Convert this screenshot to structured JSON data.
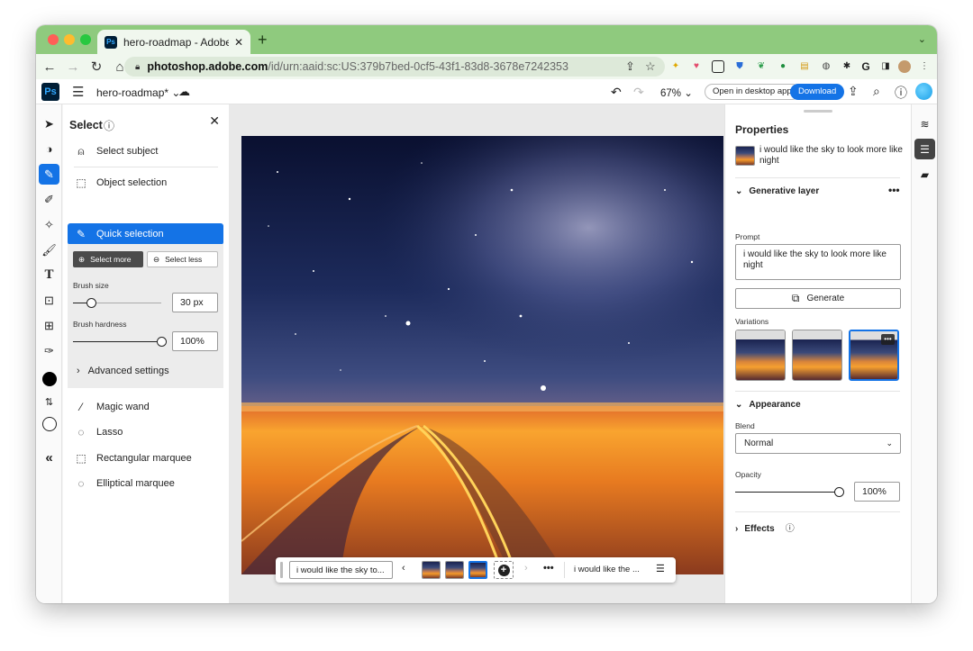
{
  "browser": {
    "tab_title": "hero-roadmap - Adobe Photos",
    "tab_favicon": "Ps",
    "url_domain": "photoshop.adobe.com",
    "url_path": "/id/urn:aaid:sc:US:379b7bed-0cf5-43f1-83d8-3678e7242353"
  },
  "app": {
    "logo": "Ps",
    "doc_name": "hero-roadmap*",
    "zoom": "67%",
    "open_desktop_label": "Open in desktop app",
    "download_label": "Download"
  },
  "select_panel": {
    "title": "Select",
    "items": {
      "select_subject": "Select subject",
      "object_selection": "Object selection",
      "quick_selection": "Quick selection",
      "magic_wand": "Magic wand",
      "lasso": "Lasso",
      "rect_marquee": "Rectangular marquee",
      "ellip_marquee": "Elliptical marquee"
    },
    "select_more": "Select more",
    "select_less": "Select less",
    "brush_size_label": "Brush size",
    "brush_size_value": "30 px",
    "brush_size_fraction": 0.2,
    "brush_hardness_label": "Brush hardness",
    "brush_hardness_value": "100%",
    "brush_hardness_fraction": 1.0,
    "advanced_label": "Advanced settings"
  },
  "gen_bar": {
    "prompt_short": "i would like the sky to...",
    "layer_short": "i would like the ..."
  },
  "properties": {
    "title": "Properties",
    "layer_name": "i would like the sky to look more like night",
    "generative_section": "Generative layer",
    "prompt_label": "Prompt",
    "prompt_value": "i would like the sky to look more like night",
    "generate_label": "Generate",
    "variations_label": "Variations",
    "appearance_section": "Appearance",
    "blend_label": "Blend",
    "blend_value": "Normal",
    "opacity_label": "Opacity",
    "opacity_value": "100%",
    "opacity_fraction": 1.0,
    "effects_section": "Effects"
  },
  "colors": {
    "accent": "#1473e6",
    "tabstrip": "#8fca7e",
    "ps_brand": "#001e36"
  }
}
